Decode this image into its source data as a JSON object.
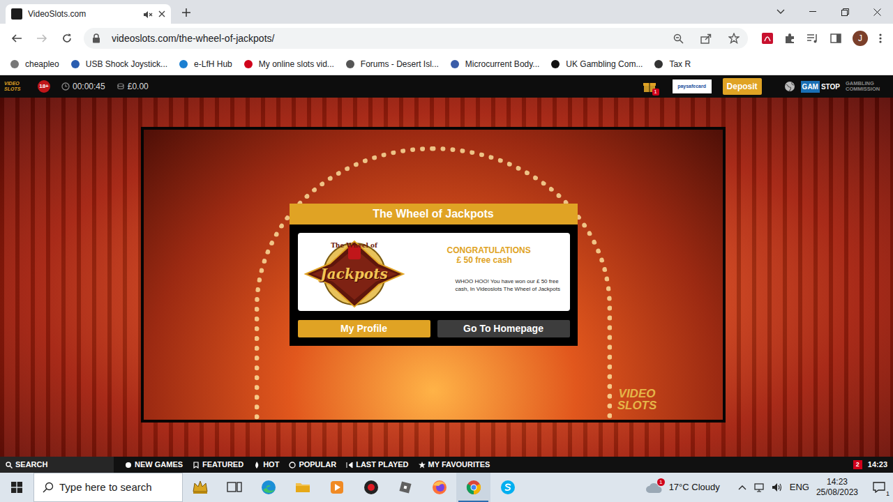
{
  "browser": {
    "tab": {
      "title": "VideoSlots.com",
      "muted": true
    },
    "url": "videoslots.com/the-wheel-of-jackpots/",
    "profile": "J",
    "bookmarks": [
      {
        "label": "cheapleo"
      },
      {
        "label": "USB Shock Joystick..."
      },
      {
        "label": "e-LfH Hub"
      },
      {
        "label": "My online slots vid..."
      },
      {
        "label": "Forums - Desert Isl..."
      },
      {
        "label": "Microcurrent Body..."
      },
      {
        "label": "UK Gambling Com..."
      },
      {
        "label": "Tax R"
      }
    ]
  },
  "site_header": {
    "logo": "VIDEO SLOTS",
    "age": "18+",
    "session_time": "00:00:45",
    "balance": "£0.00",
    "gift_count": "1",
    "payment": "paysafecard",
    "deposit": "Deposit",
    "gamstop_gam": "GAM",
    "gamstop_stop": "STOP",
    "commission": "GAMBLING COMMISSION"
  },
  "modal": {
    "title": "The Wheel of Jackpots",
    "logo_top": "The Wheel of",
    "logo_main": "Jackpots",
    "heading": "CONGRATULATIONS",
    "prize": "£ 50 free cash",
    "message": "WHOO HOO! You have won our £ 50 free cash, In Videoslots The Wheel of Jackpots",
    "buttons": [
      "My Profile",
      "Go To Homepage"
    ]
  },
  "stage_watermark": "VIDEO SLOTS",
  "site_nav": {
    "search": "SEARCH",
    "items": [
      {
        "label": "NEW GAMES"
      },
      {
        "label": "FEATURED"
      },
      {
        "label": "HOT"
      },
      {
        "label": "POPULAR"
      },
      {
        "label": "LAST PLAYED"
      },
      {
        "label": "MY FAVOURITES"
      }
    ],
    "badge": "2",
    "time": "14:23"
  },
  "taskbar": {
    "search_placeholder": "Type here to search",
    "apps": [
      {
        "kind": "widget",
        "selected": false
      },
      {
        "kind": "taskview",
        "selected": false
      },
      {
        "kind": "edge",
        "selected": false
      },
      {
        "kind": "explorer",
        "selected": false
      },
      {
        "kind": "media",
        "selected": false
      },
      {
        "kind": "recorder",
        "selected": false
      },
      {
        "kind": "roblox",
        "selected": false
      },
      {
        "kind": "firefox",
        "selected": false
      },
      {
        "kind": "chrome",
        "selected": true
      },
      {
        "kind": "skype",
        "selected": false
      }
    ],
    "weather_badge": "1",
    "weather": "17°C  Cloudy",
    "language": "ENG",
    "time": "14:23",
    "date": "25/08/2023",
    "notifications": "1"
  }
}
